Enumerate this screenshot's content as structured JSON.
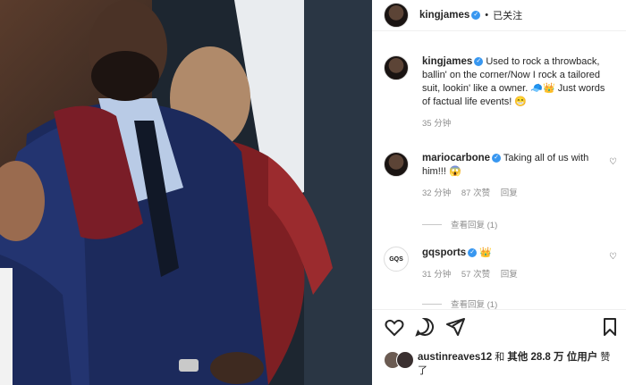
{
  "header": {
    "username": "kingjames",
    "follow_status": "已关注",
    "separator": "•"
  },
  "caption": {
    "username": "kingjames",
    "text": "Used to rock a throwback, ballin' on the corner/Now I rock a tailored suit, lookin' like a owner. 🧢👑 Just words of factual life events! 😁",
    "time": "35 分钟"
  },
  "comments": [
    {
      "username": "mariocarbone",
      "text": "Taking all of us with him!!! 😱",
      "time": "32 分钟",
      "likes": "87 次赞",
      "reply": "回复",
      "view_replies": "查看回复 (1)"
    },
    {
      "username": "gqsports",
      "text": "👑",
      "avatar_text": "GQS",
      "time": "31 分钟",
      "likes": "57 次赞",
      "reply": "回复",
      "view_replies": "查看回复 (1)"
    }
  ],
  "likes_line": {
    "user": "austinreaves12",
    "text_1": "和",
    "text_2": "其他 28.8 万 位用户",
    "text_3": "赞了"
  },
  "colors": {
    "verified": "#3897f0",
    "muted": "#8e8e8e",
    "text": "#262626"
  }
}
